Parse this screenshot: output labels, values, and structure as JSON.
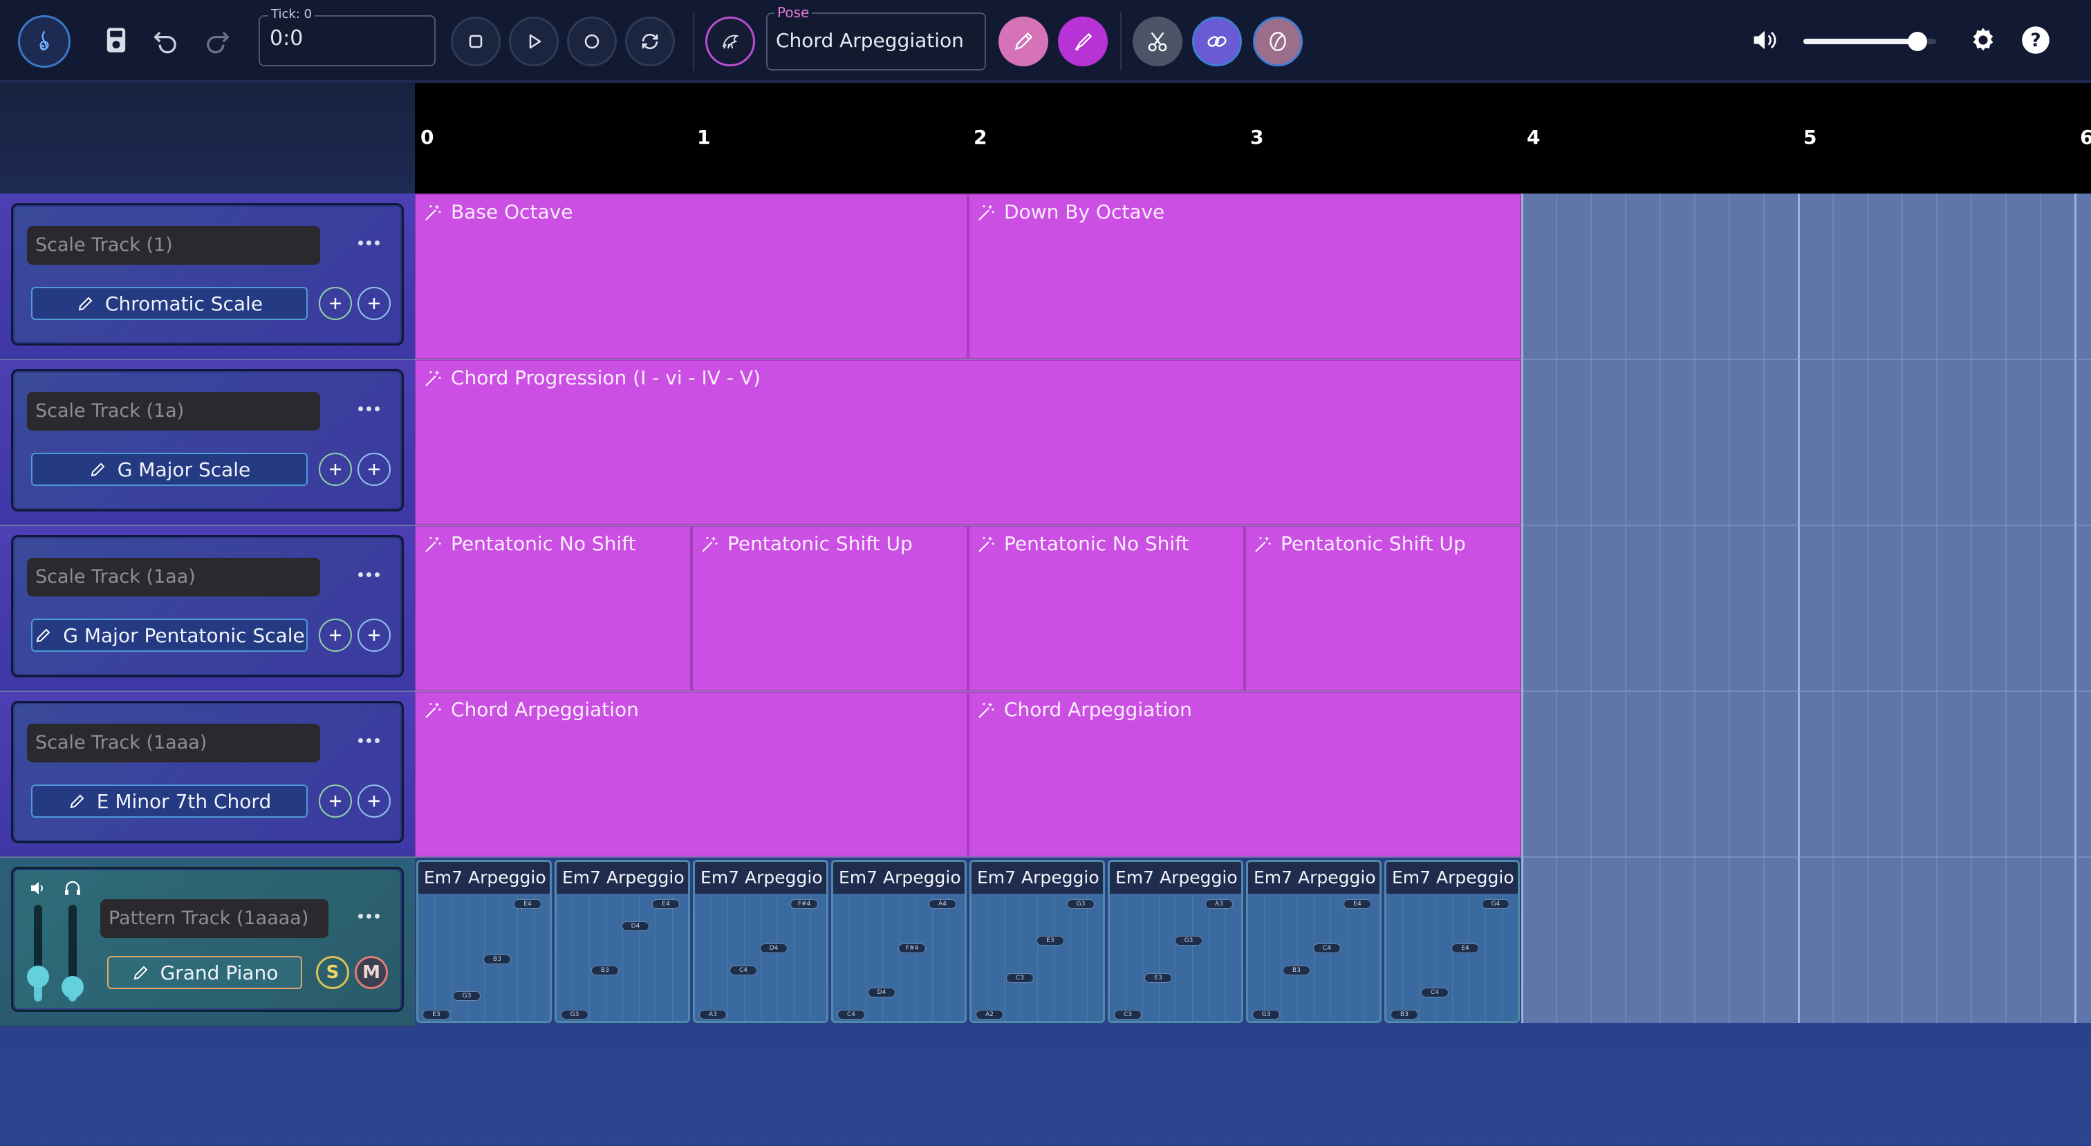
{
  "toolbar": {
    "tick_label": "Tick: 0",
    "tick_value": "0:0",
    "pose_label": "Pose",
    "pose_value": "Chord Arpeggiation",
    "volume_level": 0.86,
    "icons": [
      "treble-clef-icon",
      "save-icon",
      "undo-icon",
      "redo-icon",
      "stop-icon",
      "play-icon",
      "record-icon",
      "loop-icon",
      "pose-icon",
      "pencil-icon",
      "brush-icon",
      "scissors-icon",
      "link-icon",
      "transpose-icon",
      "volume-icon",
      "settings-icon",
      "help-icon"
    ]
  },
  "ruler": {
    "labels": [
      "0",
      "1",
      "2",
      "3",
      "4",
      "5",
      "6"
    ]
  },
  "tracks": [
    {
      "name": "Scale Track (1)",
      "instrument": "Chromatic Scale",
      "clips": [
        {
          "title": "Base Octave"
        },
        {
          "title": "Down By Octave"
        }
      ]
    },
    {
      "name": "Scale Track (1a)",
      "instrument": "G Major Scale",
      "clips": [
        {
          "title": "Chord Progression (I - vi - IV - V)"
        }
      ]
    },
    {
      "name": "Scale Track (1aa)",
      "instrument": "G Major Pentatonic Scale",
      "clips": [
        {
          "title": "Pentatonic No Shift"
        },
        {
          "title": "Pentatonic Shift Up"
        },
        {
          "title": "Pentatonic No Shift"
        },
        {
          "title": "Pentatonic Shift Up"
        }
      ]
    },
    {
      "name": "Scale Track (1aaa)",
      "instrument": "E Minor 7th Chord",
      "clips": [
        {
          "title": "Chord Arpeggiation"
        },
        {
          "title": "Chord Arpeggiation"
        }
      ]
    }
  ],
  "pattern_track": {
    "name": "Pattern Track (1aaaa)",
    "instrument": "Grand Piano",
    "solo_label": "S",
    "mute_label": "M",
    "volume_level": 0.36,
    "pan_level": 0.25,
    "clips": [
      {
        "title": "Em7 Arpeggio",
        "notes": [
          "E3",
          "G3",
          "B3",
          "E4"
        ]
      },
      {
        "title": "Em7 Arpeggio",
        "notes": [
          "G3",
          "B3",
          "D4",
          "E4"
        ]
      },
      {
        "title": "Em7 Arpeggio",
        "notes": [
          "A3",
          "C4",
          "D4",
          "F#4"
        ]
      },
      {
        "title": "Em7 Arpeggio",
        "notes": [
          "C4",
          "D4",
          "F#4",
          "A4"
        ]
      },
      {
        "title": "Em7 Arpeggio",
        "notes": [
          "A2",
          "C3",
          "E3",
          "G3"
        ]
      },
      {
        "title": "Em7 Arpeggio",
        "notes": [
          "C3",
          "E3",
          "G3",
          "A3"
        ]
      },
      {
        "title": "Em7 Arpeggio",
        "notes": [
          "G3",
          "B3",
          "C4",
          "E4"
        ]
      },
      {
        "title": "Em7 Arpeggio",
        "notes": [
          "B3",
          "C4",
          "E4",
          "G4"
        ]
      }
    ]
  },
  "colors": {
    "clip": "#cc4fe3",
    "pattern_clip": "#3a6a9f",
    "track_header": "#4d3fb4",
    "pattern_header": "#2c5f7a",
    "toolbar": "#121a33"
  }
}
